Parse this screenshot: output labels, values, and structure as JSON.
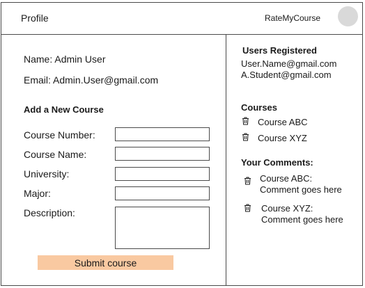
{
  "header": {
    "title": "Profile",
    "brand": "RateMyCourse"
  },
  "profile": {
    "name": "Name: Admin User",
    "email": "Email: Admin.User@gmail.com"
  },
  "form": {
    "title": "Add a New Course",
    "fields": [
      {
        "label": "Course Number:",
        "value": ""
      },
      {
        "label": "Course Name:",
        "value": ""
      },
      {
        "label": "University:",
        "value": ""
      },
      {
        "label": "Major:",
        "value": ""
      },
      {
        "label": "Description:",
        "value": ""
      }
    ],
    "submit_label": "Submit course"
  },
  "users": {
    "title": "Users Registered",
    "items": [
      "User.Name@gmail.com",
      "A.Student@gmail.com"
    ]
  },
  "courses": {
    "title": "Courses",
    "items": [
      "Course ABC",
      "Course XYZ"
    ]
  },
  "comments": {
    "title": "Your Comments:",
    "items": [
      {
        "course": "Course ABC:",
        "text": "Comment goes here"
      },
      {
        "course": "Course XYZ:",
        "text": "Comment goes here"
      }
    ]
  },
  "colors": {
    "submit_bg": "#f9c9a1",
    "avatar": "#d9d9d9",
    "border": "#4a4a4a"
  },
  "icons": {
    "avatar": "avatar",
    "delete": "trash-icon"
  }
}
